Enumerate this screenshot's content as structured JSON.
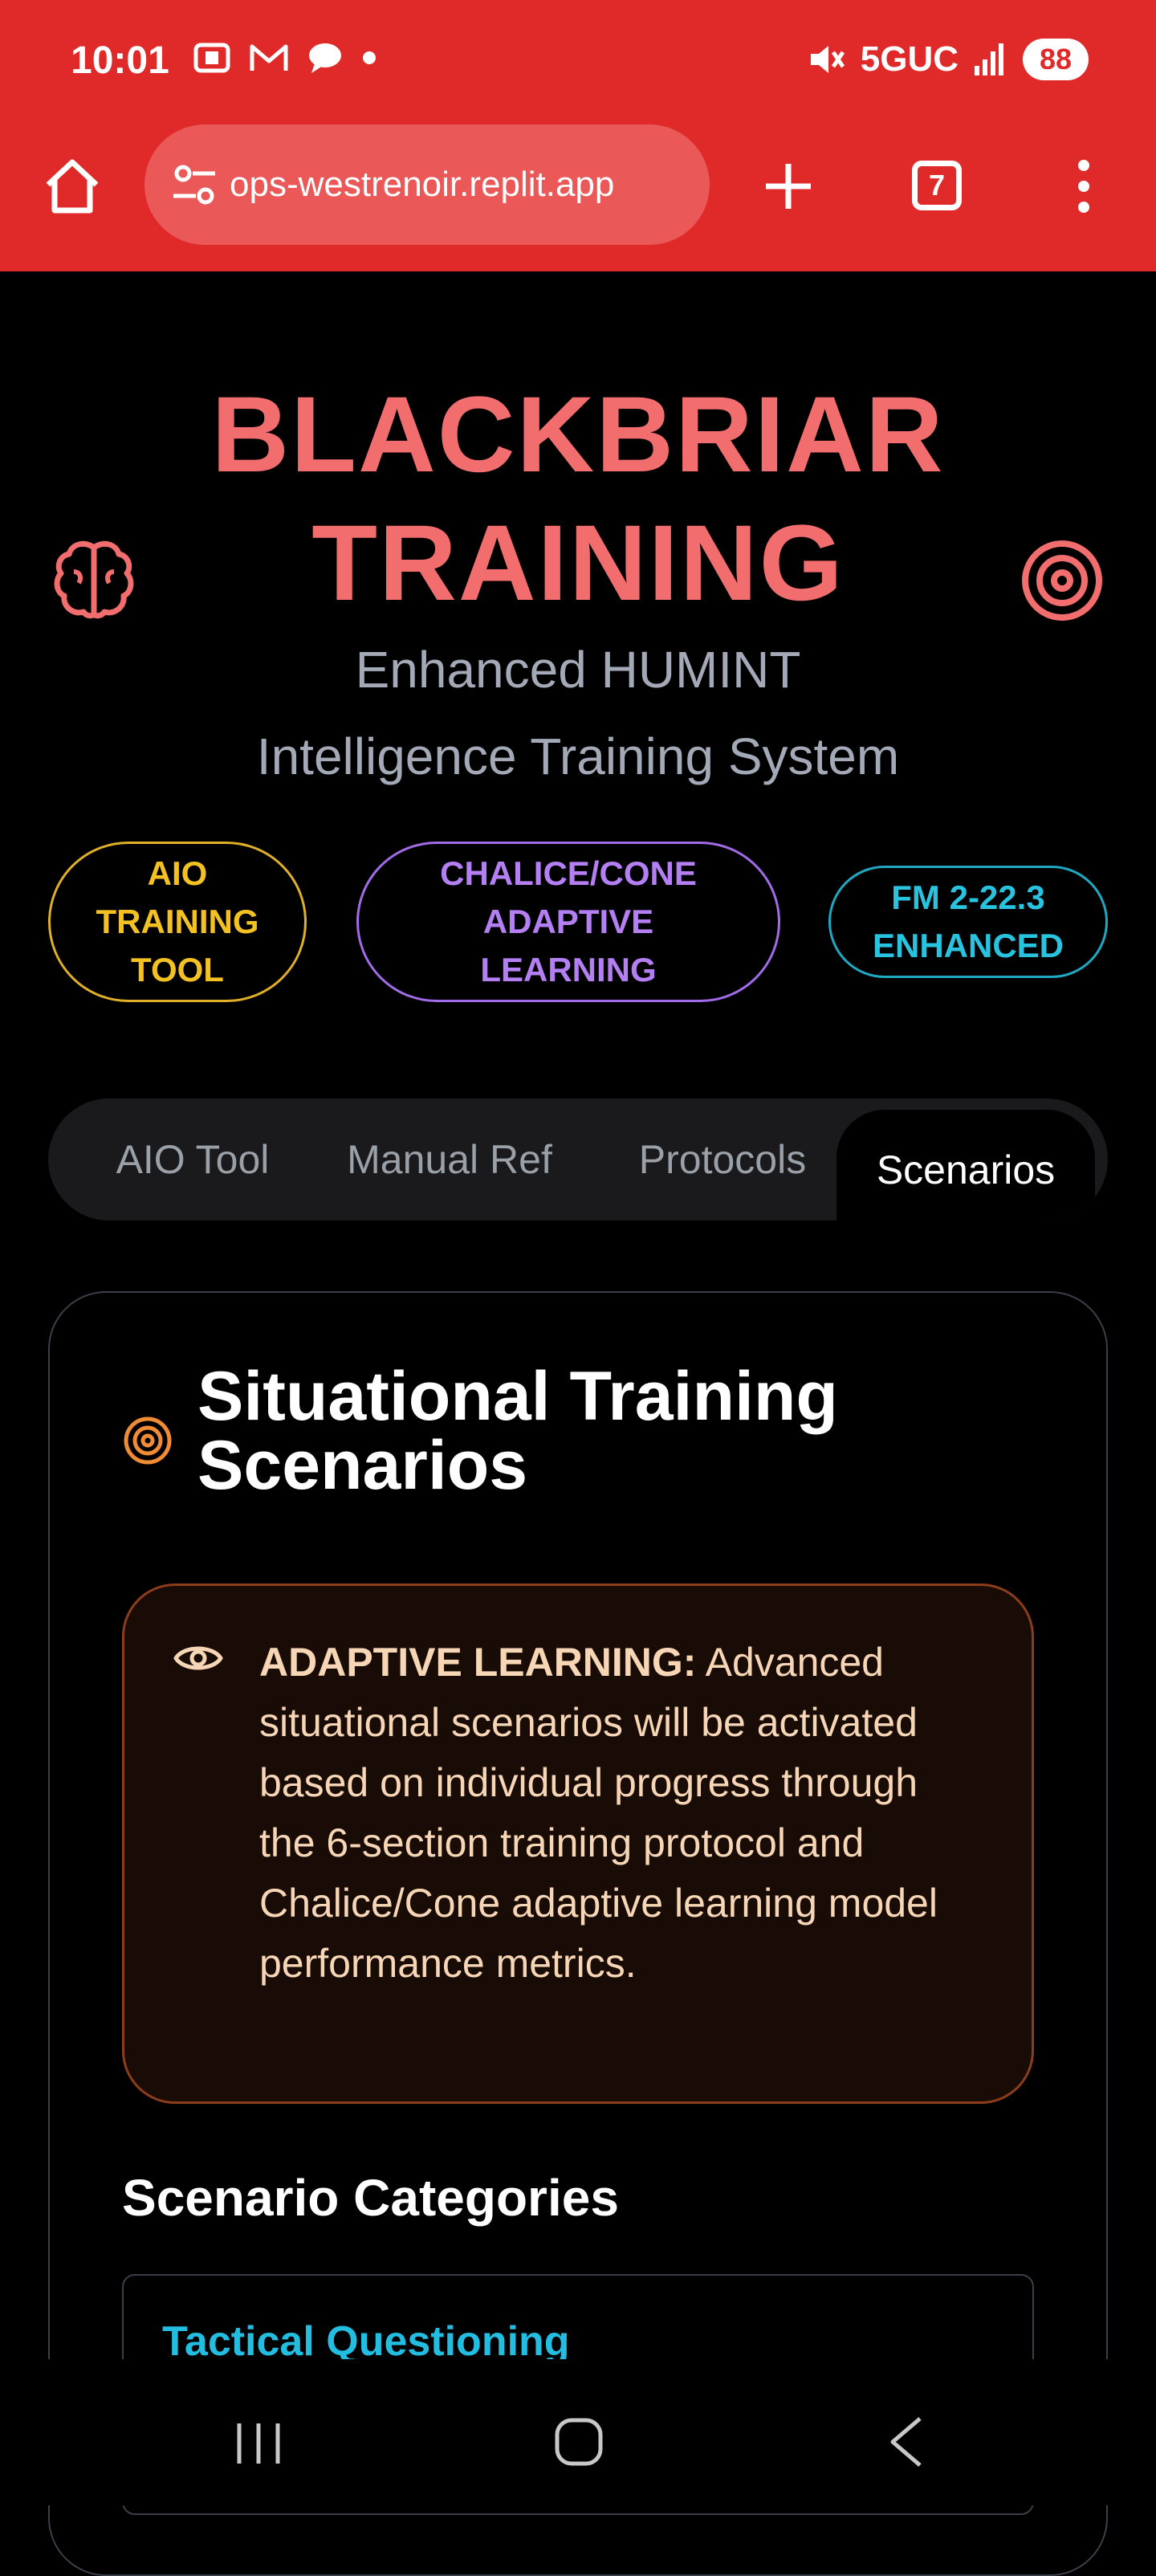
{
  "status_bar": {
    "time": "10:01",
    "network": "5GUC",
    "battery": "88",
    "icons": [
      "screenshot-icon",
      "gmail-icon",
      "chat-bubble-icon",
      "dot-icon",
      "mute-icon",
      "signal-icon"
    ]
  },
  "browser": {
    "url": "ops-westrenoir.replit.app",
    "tab_count": "7"
  },
  "hero": {
    "title_line1": "BLACKBRIAR",
    "title_line2": "TRAINING",
    "subtitle_line1": "Enhanced HUMINT",
    "subtitle_line2": "Intelligence Training System"
  },
  "badges": [
    {
      "line1": "AIO",
      "line2": "TRAINING",
      "line3": "TOOL",
      "color": "#f3c122"
    },
    {
      "line1": "CHALICE/CONE",
      "line2": "ADAPTIVE",
      "line3": "LEARNING",
      "color": "#b47ff2"
    },
    {
      "line1": "FM 2-22.3",
      "line2": "ENHANCED",
      "color": "#28c3df"
    }
  ],
  "tabs": [
    {
      "label": "AIO Tool",
      "active": false
    },
    {
      "label": "Manual Ref",
      "active": false
    },
    {
      "label": "Protocols",
      "active": false
    },
    {
      "label": "Scenarios",
      "active": true
    }
  ],
  "card": {
    "title": "Situational Training Scenarios",
    "alert_label": "ADAPTIVE LEARNING:",
    "alert_body": " Advanced situational scenarios will be activated based on individual progress through the 6-section training protocol and Chalice/Cone adaptive learning model performance metrics.",
    "section_heading": "Scenario Categories",
    "categories": [
      {
        "title": "Tactical Questioning"
      }
    ]
  },
  "colors": {
    "chrome": "#e02a2a",
    "title": "#f26d6d",
    "accent_orange": "#f08c34",
    "accent_cyan": "#22bde0"
  }
}
